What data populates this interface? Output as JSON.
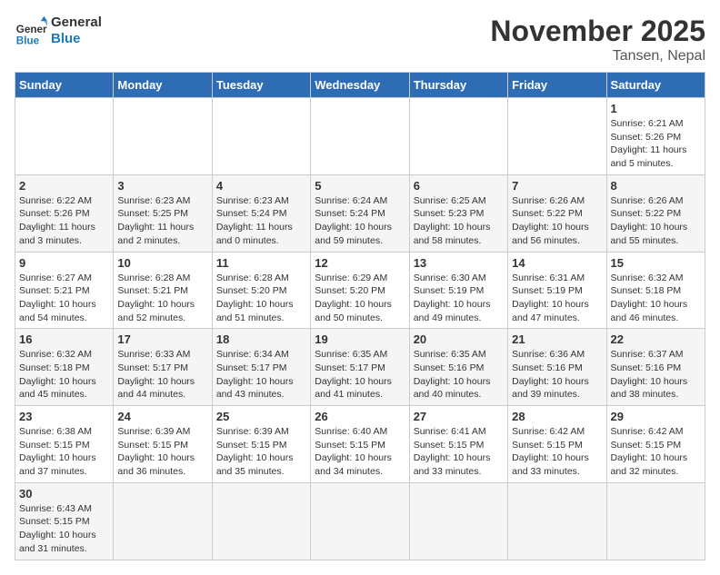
{
  "header": {
    "logo_line1": "General",
    "logo_line2": "Blue",
    "month": "November 2025",
    "location": "Tansen, Nepal"
  },
  "weekdays": [
    "Sunday",
    "Monday",
    "Tuesday",
    "Wednesday",
    "Thursday",
    "Friday",
    "Saturday"
  ],
  "weeks": [
    [
      {
        "day": "",
        "info": ""
      },
      {
        "day": "",
        "info": ""
      },
      {
        "day": "",
        "info": ""
      },
      {
        "day": "",
        "info": ""
      },
      {
        "day": "",
        "info": ""
      },
      {
        "day": "",
        "info": ""
      },
      {
        "day": "1",
        "info": "Sunrise: 6:21 AM\nSunset: 5:26 PM\nDaylight: 11 hours and 5 minutes."
      }
    ],
    [
      {
        "day": "2",
        "info": "Sunrise: 6:22 AM\nSunset: 5:26 PM\nDaylight: 11 hours and 3 minutes."
      },
      {
        "day": "3",
        "info": "Sunrise: 6:23 AM\nSunset: 5:25 PM\nDaylight: 11 hours and 2 minutes."
      },
      {
        "day": "4",
        "info": "Sunrise: 6:23 AM\nSunset: 5:24 PM\nDaylight: 11 hours and 0 minutes."
      },
      {
        "day": "5",
        "info": "Sunrise: 6:24 AM\nSunset: 5:24 PM\nDaylight: 10 hours and 59 minutes."
      },
      {
        "day": "6",
        "info": "Sunrise: 6:25 AM\nSunset: 5:23 PM\nDaylight: 10 hours and 58 minutes."
      },
      {
        "day": "7",
        "info": "Sunrise: 6:26 AM\nSunset: 5:22 PM\nDaylight: 10 hours and 56 minutes."
      },
      {
        "day": "8",
        "info": "Sunrise: 6:26 AM\nSunset: 5:22 PM\nDaylight: 10 hours and 55 minutes."
      }
    ],
    [
      {
        "day": "9",
        "info": "Sunrise: 6:27 AM\nSunset: 5:21 PM\nDaylight: 10 hours and 54 minutes."
      },
      {
        "day": "10",
        "info": "Sunrise: 6:28 AM\nSunset: 5:21 PM\nDaylight: 10 hours and 52 minutes."
      },
      {
        "day": "11",
        "info": "Sunrise: 6:28 AM\nSunset: 5:20 PM\nDaylight: 10 hours and 51 minutes."
      },
      {
        "day": "12",
        "info": "Sunrise: 6:29 AM\nSunset: 5:20 PM\nDaylight: 10 hours and 50 minutes."
      },
      {
        "day": "13",
        "info": "Sunrise: 6:30 AM\nSunset: 5:19 PM\nDaylight: 10 hours and 49 minutes."
      },
      {
        "day": "14",
        "info": "Sunrise: 6:31 AM\nSunset: 5:19 PM\nDaylight: 10 hours and 47 minutes."
      },
      {
        "day": "15",
        "info": "Sunrise: 6:32 AM\nSunset: 5:18 PM\nDaylight: 10 hours and 46 minutes."
      }
    ],
    [
      {
        "day": "16",
        "info": "Sunrise: 6:32 AM\nSunset: 5:18 PM\nDaylight: 10 hours and 45 minutes."
      },
      {
        "day": "17",
        "info": "Sunrise: 6:33 AM\nSunset: 5:17 PM\nDaylight: 10 hours and 44 minutes."
      },
      {
        "day": "18",
        "info": "Sunrise: 6:34 AM\nSunset: 5:17 PM\nDaylight: 10 hours and 43 minutes."
      },
      {
        "day": "19",
        "info": "Sunrise: 6:35 AM\nSunset: 5:17 PM\nDaylight: 10 hours and 41 minutes."
      },
      {
        "day": "20",
        "info": "Sunrise: 6:35 AM\nSunset: 5:16 PM\nDaylight: 10 hours and 40 minutes."
      },
      {
        "day": "21",
        "info": "Sunrise: 6:36 AM\nSunset: 5:16 PM\nDaylight: 10 hours and 39 minutes."
      },
      {
        "day": "22",
        "info": "Sunrise: 6:37 AM\nSunset: 5:16 PM\nDaylight: 10 hours and 38 minutes."
      }
    ],
    [
      {
        "day": "23",
        "info": "Sunrise: 6:38 AM\nSunset: 5:15 PM\nDaylight: 10 hours and 37 minutes."
      },
      {
        "day": "24",
        "info": "Sunrise: 6:39 AM\nSunset: 5:15 PM\nDaylight: 10 hours and 36 minutes."
      },
      {
        "day": "25",
        "info": "Sunrise: 6:39 AM\nSunset: 5:15 PM\nDaylight: 10 hours and 35 minutes."
      },
      {
        "day": "26",
        "info": "Sunrise: 6:40 AM\nSunset: 5:15 PM\nDaylight: 10 hours and 34 minutes."
      },
      {
        "day": "27",
        "info": "Sunrise: 6:41 AM\nSunset: 5:15 PM\nDaylight: 10 hours and 33 minutes."
      },
      {
        "day": "28",
        "info": "Sunrise: 6:42 AM\nSunset: 5:15 PM\nDaylight: 10 hours and 33 minutes."
      },
      {
        "day": "29",
        "info": "Sunrise: 6:42 AM\nSunset: 5:15 PM\nDaylight: 10 hours and 32 minutes."
      }
    ],
    [
      {
        "day": "30",
        "info": "Sunrise: 6:43 AM\nSunset: 5:15 PM\nDaylight: 10 hours and 31 minutes."
      },
      {
        "day": "",
        "info": ""
      },
      {
        "day": "",
        "info": ""
      },
      {
        "day": "",
        "info": ""
      },
      {
        "day": "",
        "info": ""
      },
      {
        "day": "",
        "info": ""
      },
      {
        "day": "",
        "info": ""
      }
    ]
  ]
}
